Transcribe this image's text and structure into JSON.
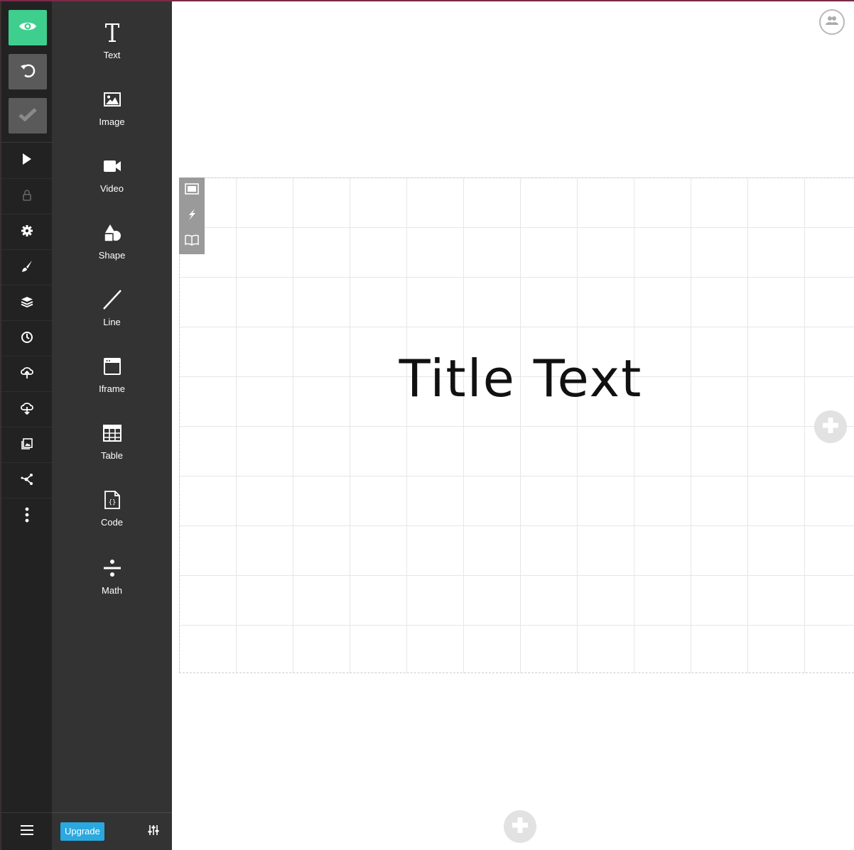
{
  "components": [
    {
      "label": "Text",
      "icon": "text-icon"
    },
    {
      "label": "Image",
      "icon": "image-icon"
    },
    {
      "label": "Video",
      "icon": "video-icon"
    },
    {
      "label": "Shape",
      "icon": "shape-icon"
    },
    {
      "label": "Line",
      "icon": "line-icon"
    },
    {
      "label": "Iframe",
      "icon": "iframe-icon"
    },
    {
      "label": "Table",
      "icon": "table-icon"
    },
    {
      "label": "Code",
      "icon": "code-icon"
    },
    {
      "label": "Math",
      "icon": "math-icon"
    }
  ],
  "rail": {
    "top_buttons": [
      "preview-icon",
      "undo-icon",
      "save-check-icon"
    ],
    "items": [
      "play-icon",
      "lock-icon",
      "gear-icon",
      "brush-icon",
      "layers-icon",
      "history-icon",
      "upload-cloud-icon",
      "download-cloud-icon",
      "media-library-icon",
      "share-icon",
      "more-vertical-icon"
    ],
    "bottom": "menu-icon"
  },
  "panel": {
    "upgrade_label": "Upgrade",
    "settings_icon": "sliders-icon"
  },
  "slide": {
    "title": "Title Text",
    "tools": [
      "slide-background-icon",
      "animation-icon",
      "speaker-notes-icon"
    ]
  },
  "colors": {
    "accent_green": "#3ecf8e",
    "upgrade_blue": "#2aa8e0",
    "rail_bg": "#222222",
    "panel_bg": "#333333"
  }
}
